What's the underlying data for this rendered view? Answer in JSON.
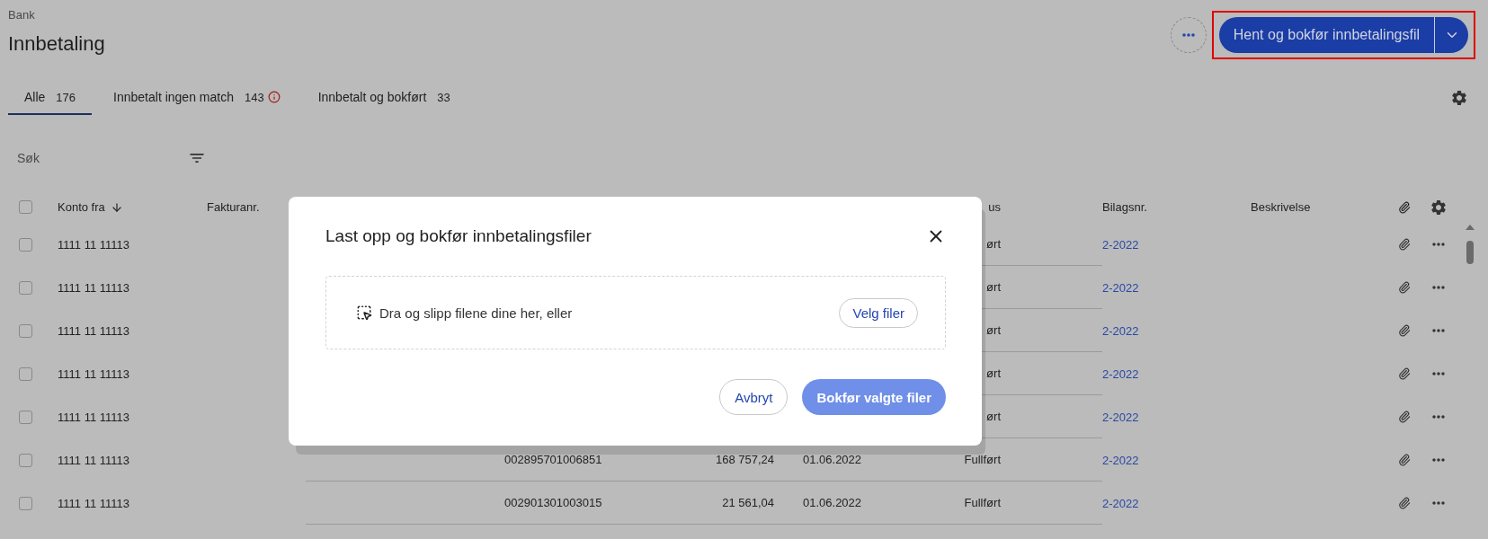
{
  "breadcrumb": "Bank",
  "title": "Innbetaling",
  "primary_action": {
    "label": "Hent og bokfør innbetalingsfil",
    "highlighted": true
  },
  "tabs": [
    {
      "label": "Alle",
      "count": "176",
      "selected": true,
      "warning": false
    },
    {
      "label": "Innbetalt ingen match",
      "count": "143",
      "selected": false,
      "warning": true
    },
    {
      "label": "Innbetalt og bokført",
      "count": "33",
      "selected": false,
      "warning": false
    }
  ],
  "search": {
    "placeholder": "Søk"
  },
  "table": {
    "all_checked": false,
    "columns": [
      {
        "label": "Konto fra",
        "sorted": true
      },
      {
        "label": "Fakturanr.",
        "sorted": false
      },
      {
        "label": "us",
        "sorted": false
      },
      {
        "label": "Bilagsnr.",
        "sorted": false
      },
      {
        "label": "Beskrivelse",
        "sorted": false
      }
    ],
    "rows": [
      {
        "checked": false,
        "account": "1111 11 11113",
        "status": "ørt",
        "voucher": "2-2022"
      },
      {
        "checked": false,
        "account": "1111 11 11113",
        "status": "ørt",
        "voucher": "2-2022"
      },
      {
        "checked": false,
        "account": "1111 11 11113",
        "status": "ørt",
        "voucher": "2-2022"
      },
      {
        "checked": false,
        "account": "1111 11 11113",
        "status": "ørt",
        "voucher": "2-2022"
      },
      {
        "checked": false,
        "account": "1111 11 11113",
        "status": "ørt",
        "voucher": "2-2022"
      },
      {
        "checked": false,
        "account": "1111 11 11113",
        "reference": "002895701006851",
        "amount": "168 757,24",
        "date": "01.06.2022",
        "status": "Fullført",
        "voucher": "2-2022"
      },
      {
        "checked": false,
        "account": "1111 11 11113",
        "reference": "002901301003015",
        "amount": "21 561,04",
        "date": "01.06.2022",
        "status": "Fullført",
        "voucher": "2-2022"
      }
    ]
  },
  "dialog": {
    "title": "Last opp og bokfør innbetalingsfiler",
    "dropzone_text": "Dra og slipp filene dine her, eller",
    "choose_button": "Velg filer",
    "cancel_button": "Avbryt",
    "submit_button": {
      "label": "Bokfør valgte filer",
      "disabled": true
    }
  }
}
